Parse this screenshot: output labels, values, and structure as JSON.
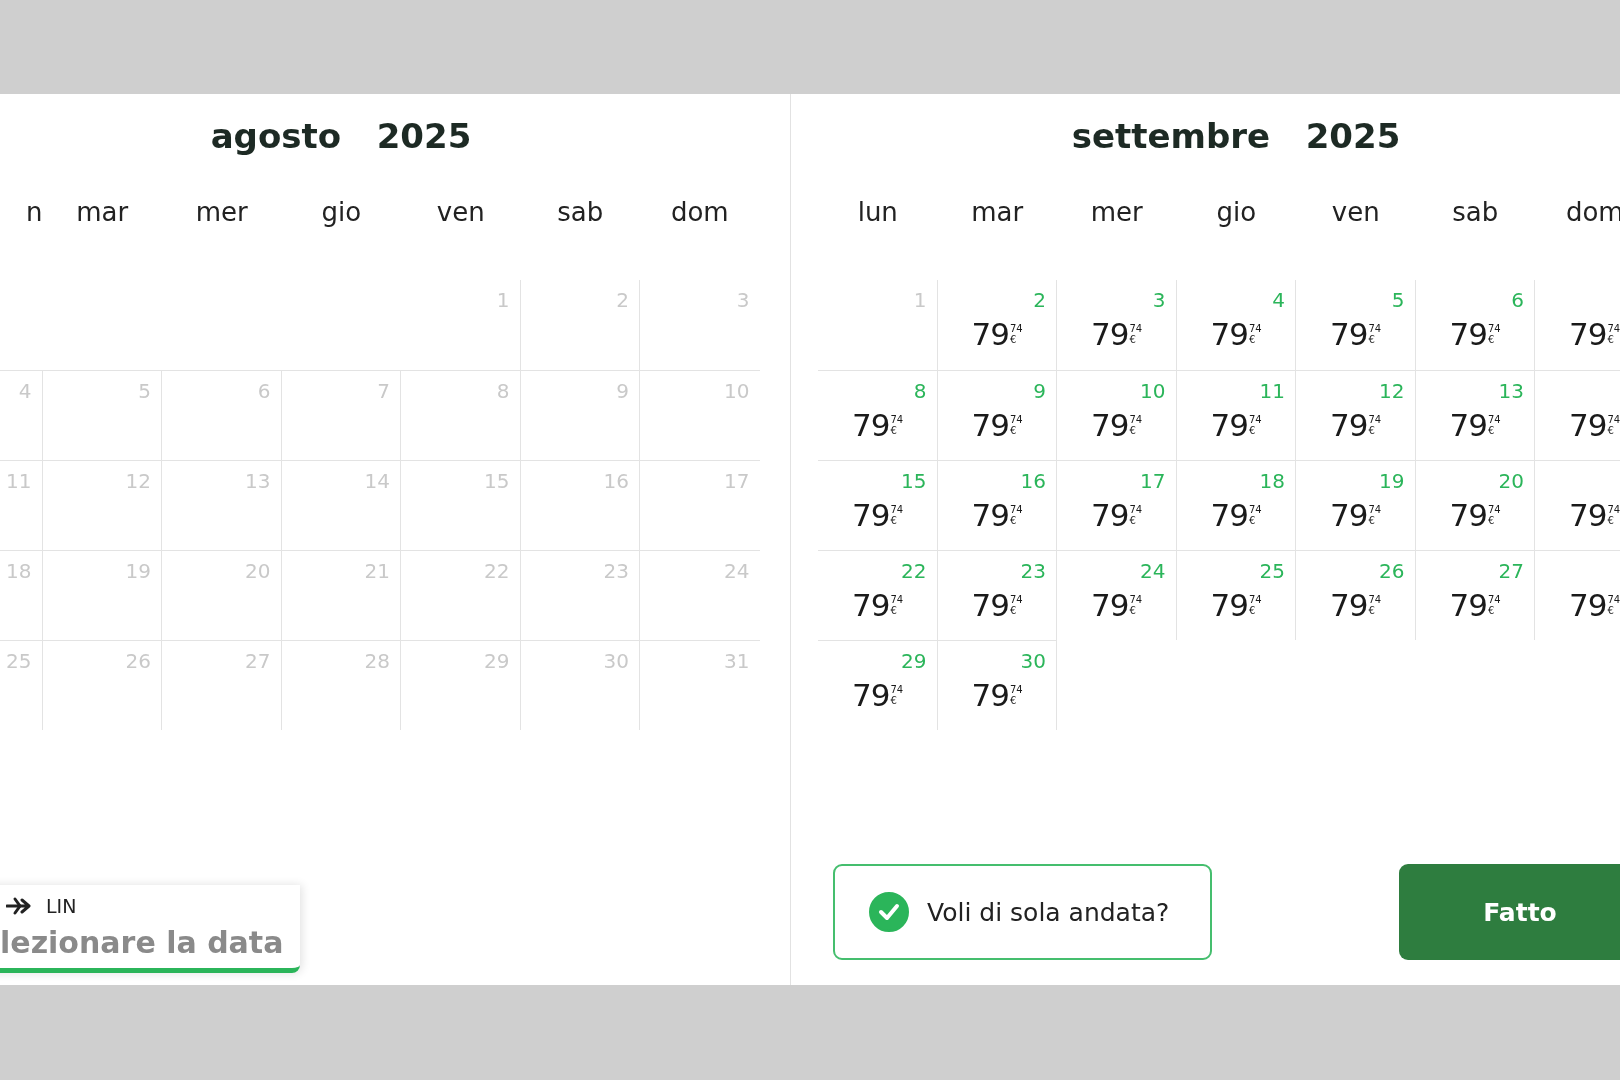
{
  "months": [
    {
      "month": "agosto",
      "year": "2025",
      "weekdays": [
        "n",
        "mar",
        "mer",
        "gio",
        "ven",
        "sab",
        "dom"
      ],
      "days": [
        {
          "kind": "blank"
        },
        {
          "kind": "blank"
        },
        {
          "kind": "blank"
        },
        {
          "kind": "blank"
        },
        {
          "kind": "unavailable",
          "day": "1"
        },
        {
          "kind": "unavailable",
          "day": "2"
        },
        {
          "kind": "unavailable",
          "day": "3"
        },
        {
          "kind": "unavailable",
          "day": "4"
        },
        {
          "kind": "unavailable",
          "day": "5"
        },
        {
          "kind": "unavailable",
          "day": "6"
        },
        {
          "kind": "unavailable",
          "day": "7"
        },
        {
          "kind": "unavailable",
          "day": "8"
        },
        {
          "kind": "unavailable",
          "day": "9"
        },
        {
          "kind": "unavailable",
          "day": "10"
        },
        {
          "kind": "unavailable",
          "day": "11"
        },
        {
          "kind": "unavailable",
          "day": "12"
        },
        {
          "kind": "unavailable",
          "day": "13"
        },
        {
          "kind": "unavailable",
          "day": "14"
        },
        {
          "kind": "unavailable",
          "day": "15"
        },
        {
          "kind": "unavailable",
          "day": "16"
        },
        {
          "kind": "unavailable",
          "day": "17"
        },
        {
          "kind": "unavailable",
          "day": "18"
        },
        {
          "kind": "unavailable",
          "day": "19"
        },
        {
          "kind": "unavailable",
          "day": "20"
        },
        {
          "kind": "unavailable",
          "day": "21"
        },
        {
          "kind": "unavailable",
          "day": "22"
        },
        {
          "kind": "unavailable",
          "day": "23"
        },
        {
          "kind": "unavailable",
          "day": "24"
        },
        {
          "kind": "unavailable",
          "day": "25"
        },
        {
          "kind": "unavailable",
          "day": "26"
        },
        {
          "kind": "unavailable",
          "day": "27"
        },
        {
          "kind": "unavailable",
          "day": "28"
        },
        {
          "kind": "unavailable",
          "day": "29"
        },
        {
          "kind": "unavailable",
          "day": "30"
        },
        {
          "kind": "unavailable",
          "day": "31"
        }
      ]
    },
    {
      "month": "settembre",
      "year": "2025",
      "weekdays": [
        "lun",
        "mar",
        "mer",
        "gio",
        "ven",
        "sab",
        "dom"
      ],
      "days": [
        {
          "kind": "unavailable",
          "day": "1"
        },
        {
          "kind": "available",
          "day": "2",
          "price": {
            "whole": "79",
            "cents": "74",
            "currency": "€"
          }
        },
        {
          "kind": "available",
          "day": "3",
          "price": {
            "whole": "79",
            "cents": "74",
            "currency": "€"
          }
        },
        {
          "kind": "available",
          "day": "4",
          "price": {
            "whole": "79",
            "cents": "74",
            "currency": "€"
          }
        },
        {
          "kind": "available",
          "day": "5",
          "price": {
            "whole": "79",
            "cents": "74",
            "currency": "€"
          }
        },
        {
          "kind": "available",
          "day": "6",
          "price": {
            "whole": "79",
            "cents": "74",
            "currency": "€"
          }
        },
        {
          "kind": "available",
          "price": {
            "whole": "79",
            "cents": "74",
            "currency": "€"
          }
        },
        {
          "kind": "available",
          "day": "8",
          "price": {
            "whole": "79",
            "cents": "74",
            "currency": "€"
          }
        },
        {
          "kind": "available",
          "day": "9",
          "price": {
            "whole": "79",
            "cents": "74",
            "currency": "€"
          }
        },
        {
          "kind": "available",
          "day": "10",
          "price": {
            "whole": "79",
            "cents": "74",
            "currency": "€"
          }
        },
        {
          "kind": "available",
          "day": "11",
          "price": {
            "whole": "79",
            "cents": "74",
            "currency": "€"
          }
        },
        {
          "kind": "available",
          "day": "12",
          "price": {
            "whole": "79",
            "cents": "74",
            "currency": "€"
          }
        },
        {
          "kind": "available",
          "day": "13",
          "price": {
            "whole": "79",
            "cents": "74",
            "currency": "€"
          }
        },
        {
          "kind": "available",
          "price": {
            "whole": "79",
            "cents": "74",
            "currency": "€"
          }
        },
        {
          "kind": "available",
          "day": "15",
          "price": {
            "whole": "79",
            "cents": "74",
            "currency": "€"
          }
        },
        {
          "kind": "available",
          "day": "16",
          "price": {
            "whole": "79",
            "cents": "74",
            "currency": "€"
          }
        },
        {
          "kind": "available",
          "day": "17",
          "price": {
            "whole": "79",
            "cents": "74",
            "currency": "€"
          }
        },
        {
          "kind": "available",
          "day": "18",
          "price": {
            "whole": "79",
            "cents": "74",
            "currency": "€"
          }
        },
        {
          "kind": "available",
          "day": "19",
          "price": {
            "whole": "79",
            "cents": "74",
            "currency": "€"
          }
        },
        {
          "kind": "available",
          "day": "20",
          "price": {
            "whole": "79",
            "cents": "74",
            "currency": "€"
          }
        },
        {
          "kind": "available",
          "price": {
            "whole": "79",
            "cents": "74",
            "currency": "€"
          }
        },
        {
          "kind": "available",
          "day": "22",
          "price": {
            "whole": "79",
            "cents": "74",
            "currency": "€"
          }
        },
        {
          "kind": "available",
          "day": "23",
          "price": {
            "whole": "79",
            "cents": "74",
            "currency": "€"
          }
        },
        {
          "kind": "available",
          "day": "24",
          "price": {
            "whole": "79",
            "cents": "74",
            "currency": "€"
          }
        },
        {
          "kind": "available",
          "day": "25",
          "price": {
            "whole": "79",
            "cents": "74",
            "currency": "€"
          }
        },
        {
          "kind": "available",
          "day": "26",
          "price": {
            "whole": "79",
            "cents": "74",
            "currency": "€"
          }
        },
        {
          "kind": "available",
          "day": "27",
          "price": {
            "whole": "79",
            "cents": "74",
            "currency": "€"
          }
        },
        {
          "kind": "available",
          "price": {
            "whole": "79",
            "cents": "74",
            "currency": "€"
          }
        },
        {
          "kind": "available",
          "day": "29",
          "price": {
            "whole": "79",
            "cents": "74",
            "currency": "€"
          }
        },
        {
          "kind": "available",
          "day": "30",
          "price": {
            "whole": "79",
            "cents": "74",
            "currency": "€"
          }
        }
      ]
    }
  ],
  "route": {
    "airport": "LIN",
    "prompt": "lezionare la data"
  },
  "one_way": {
    "label": "Voli di sola andata?",
    "checked": true
  },
  "done_button": {
    "label": "Fatto"
  }
}
